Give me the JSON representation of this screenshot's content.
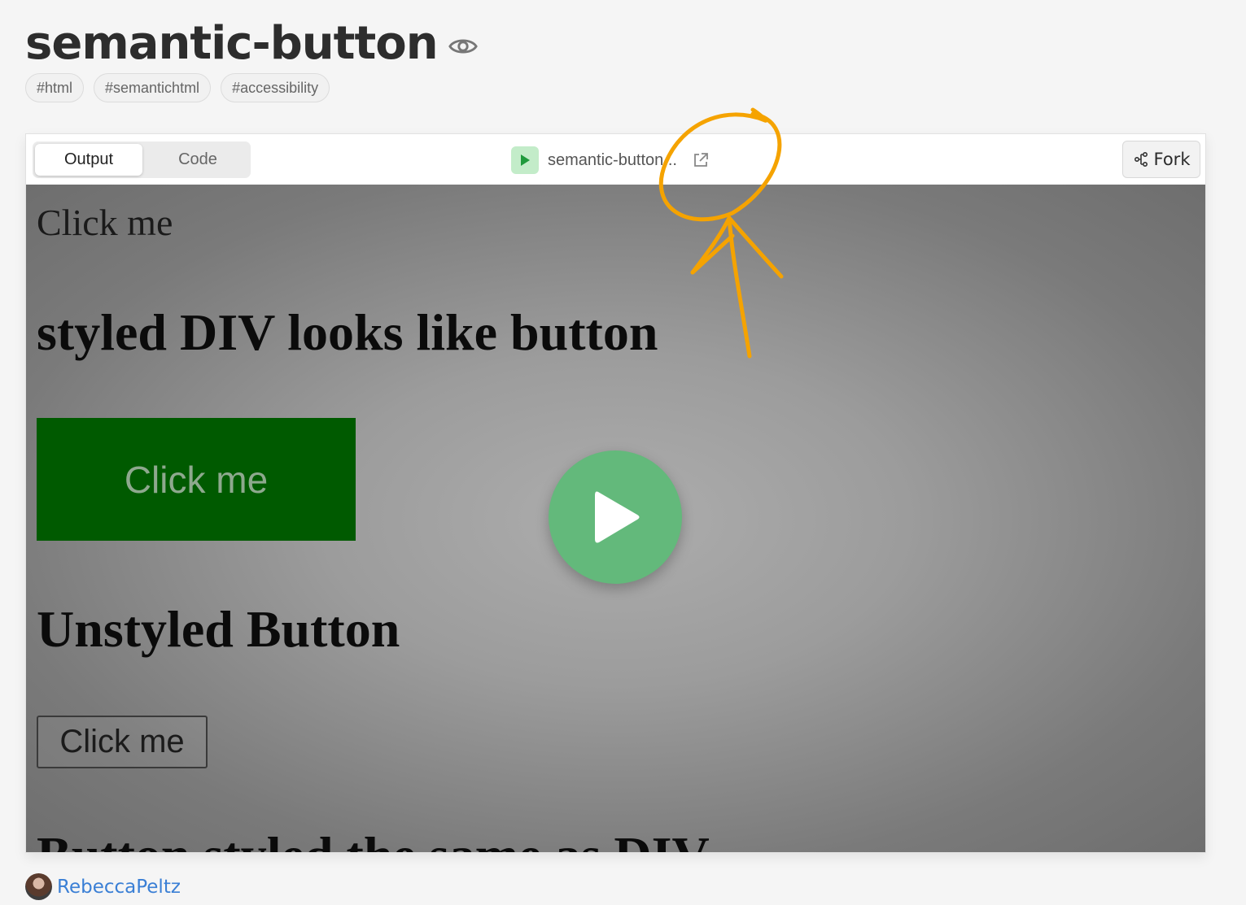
{
  "page": {
    "title": "semantic-button",
    "tags": [
      "#html",
      "#semantichtml",
      "#accessibility"
    ]
  },
  "toolbar": {
    "tabs": [
      {
        "label": "Output",
        "active": true
      },
      {
        "label": "Code",
        "active": false
      }
    ],
    "file_name": "semantic-button...",
    "fork_label": "Fork"
  },
  "preview": {
    "plain_text": "Click me",
    "heading_styled_div": "styled DIV looks like button",
    "green_div_label": "Click me",
    "heading_unstyled": "Unstyled Button",
    "unstyled_button_label": "Click me",
    "heading_button_styled": "Button styled the same as DIV"
  },
  "author": {
    "name": "RebeccaPeltz"
  },
  "colors": {
    "accent_green": "#63b97b",
    "link_blue": "#3a7fd5",
    "annotation_orange": "#f5a300",
    "preview_green_box": "#005a00"
  },
  "icons": [
    "eye-icon",
    "run-icon",
    "external-link-icon",
    "fork-icon",
    "play-icon"
  ]
}
